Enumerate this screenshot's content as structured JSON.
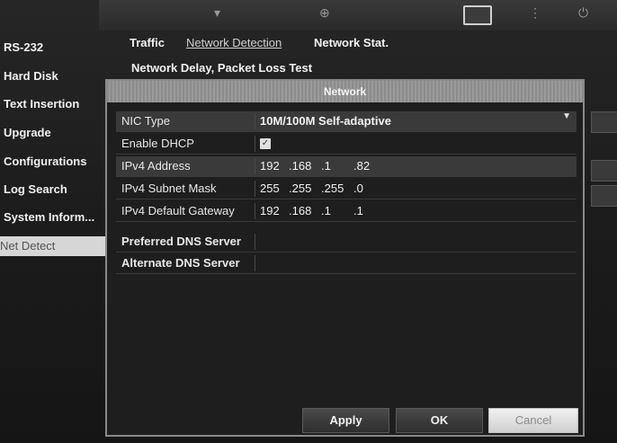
{
  "toolbar": {
    "icons": [
      "down-arrow-icon",
      "network-icon",
      "display-icon",
      "info-icon",
      "power-icon"
    ],
    "arrow_glyph": "▾"
  },
  "sidebar": {
    "items": [
      {
        "label": "RS-232"
      },
      {
        "label": "Hard Disk"
      },
      {
        "label": "Text Insertion"
      },
      {
        "label": "Upgrade"
      },
      {
        "label": "Configurations"
      },
      {
        "label": "Log Search"
      },
      {
        "label": "System Inform..."
      },
      {
        "label": "Net Detect",
        "selected": true
      }
    ]
  },
  "tabs": [
    {
      "label": "Traffic"
    },
    {
      "label": "Network Detection"
    },
    {
      "label": "Network Stat."
    }
  ],
  "subtitle": "Network Delay, Packet Loss Test",
  "dialog": {
    "title": "Network",
    "nic_type": {
      "label": "NIC Type",
      "value": "10M/100M Self-adaptive"
    },
    "dhcp": {
      "label": "Enable DHCP",
      "checked": true,
      "check_glyph": "✓"
    },
    "ipv4_address": {
      "label": "IPv4 Address",
      "octets": [
        "192",
        ".168",
        ".1",
        ".82"
      ]
    },
    "subnet_mask": {
      "label": "IPv4 Subnet Mask",
      "octets": [
        "255",
        ".255",
        ".255",
        ".0"
      ]
    },
    "gateway": {
      "label": "IPv4 Default Gateway",
      "octets": [
        "192",
        ".168",
        ".1",
        ".1"
      ]
    },
    "preferred_dns": {
      "label": "Preferred DNS Server",
      "value": ""
    },
    "alternate_dns": {
      "label": "Alternate DNS Server",
      "value": ""
    },
    "buttons": {
      "apply": "Apply",
      "ok": "OK",
      "cancel": "Cancel"
    }
  }
}
